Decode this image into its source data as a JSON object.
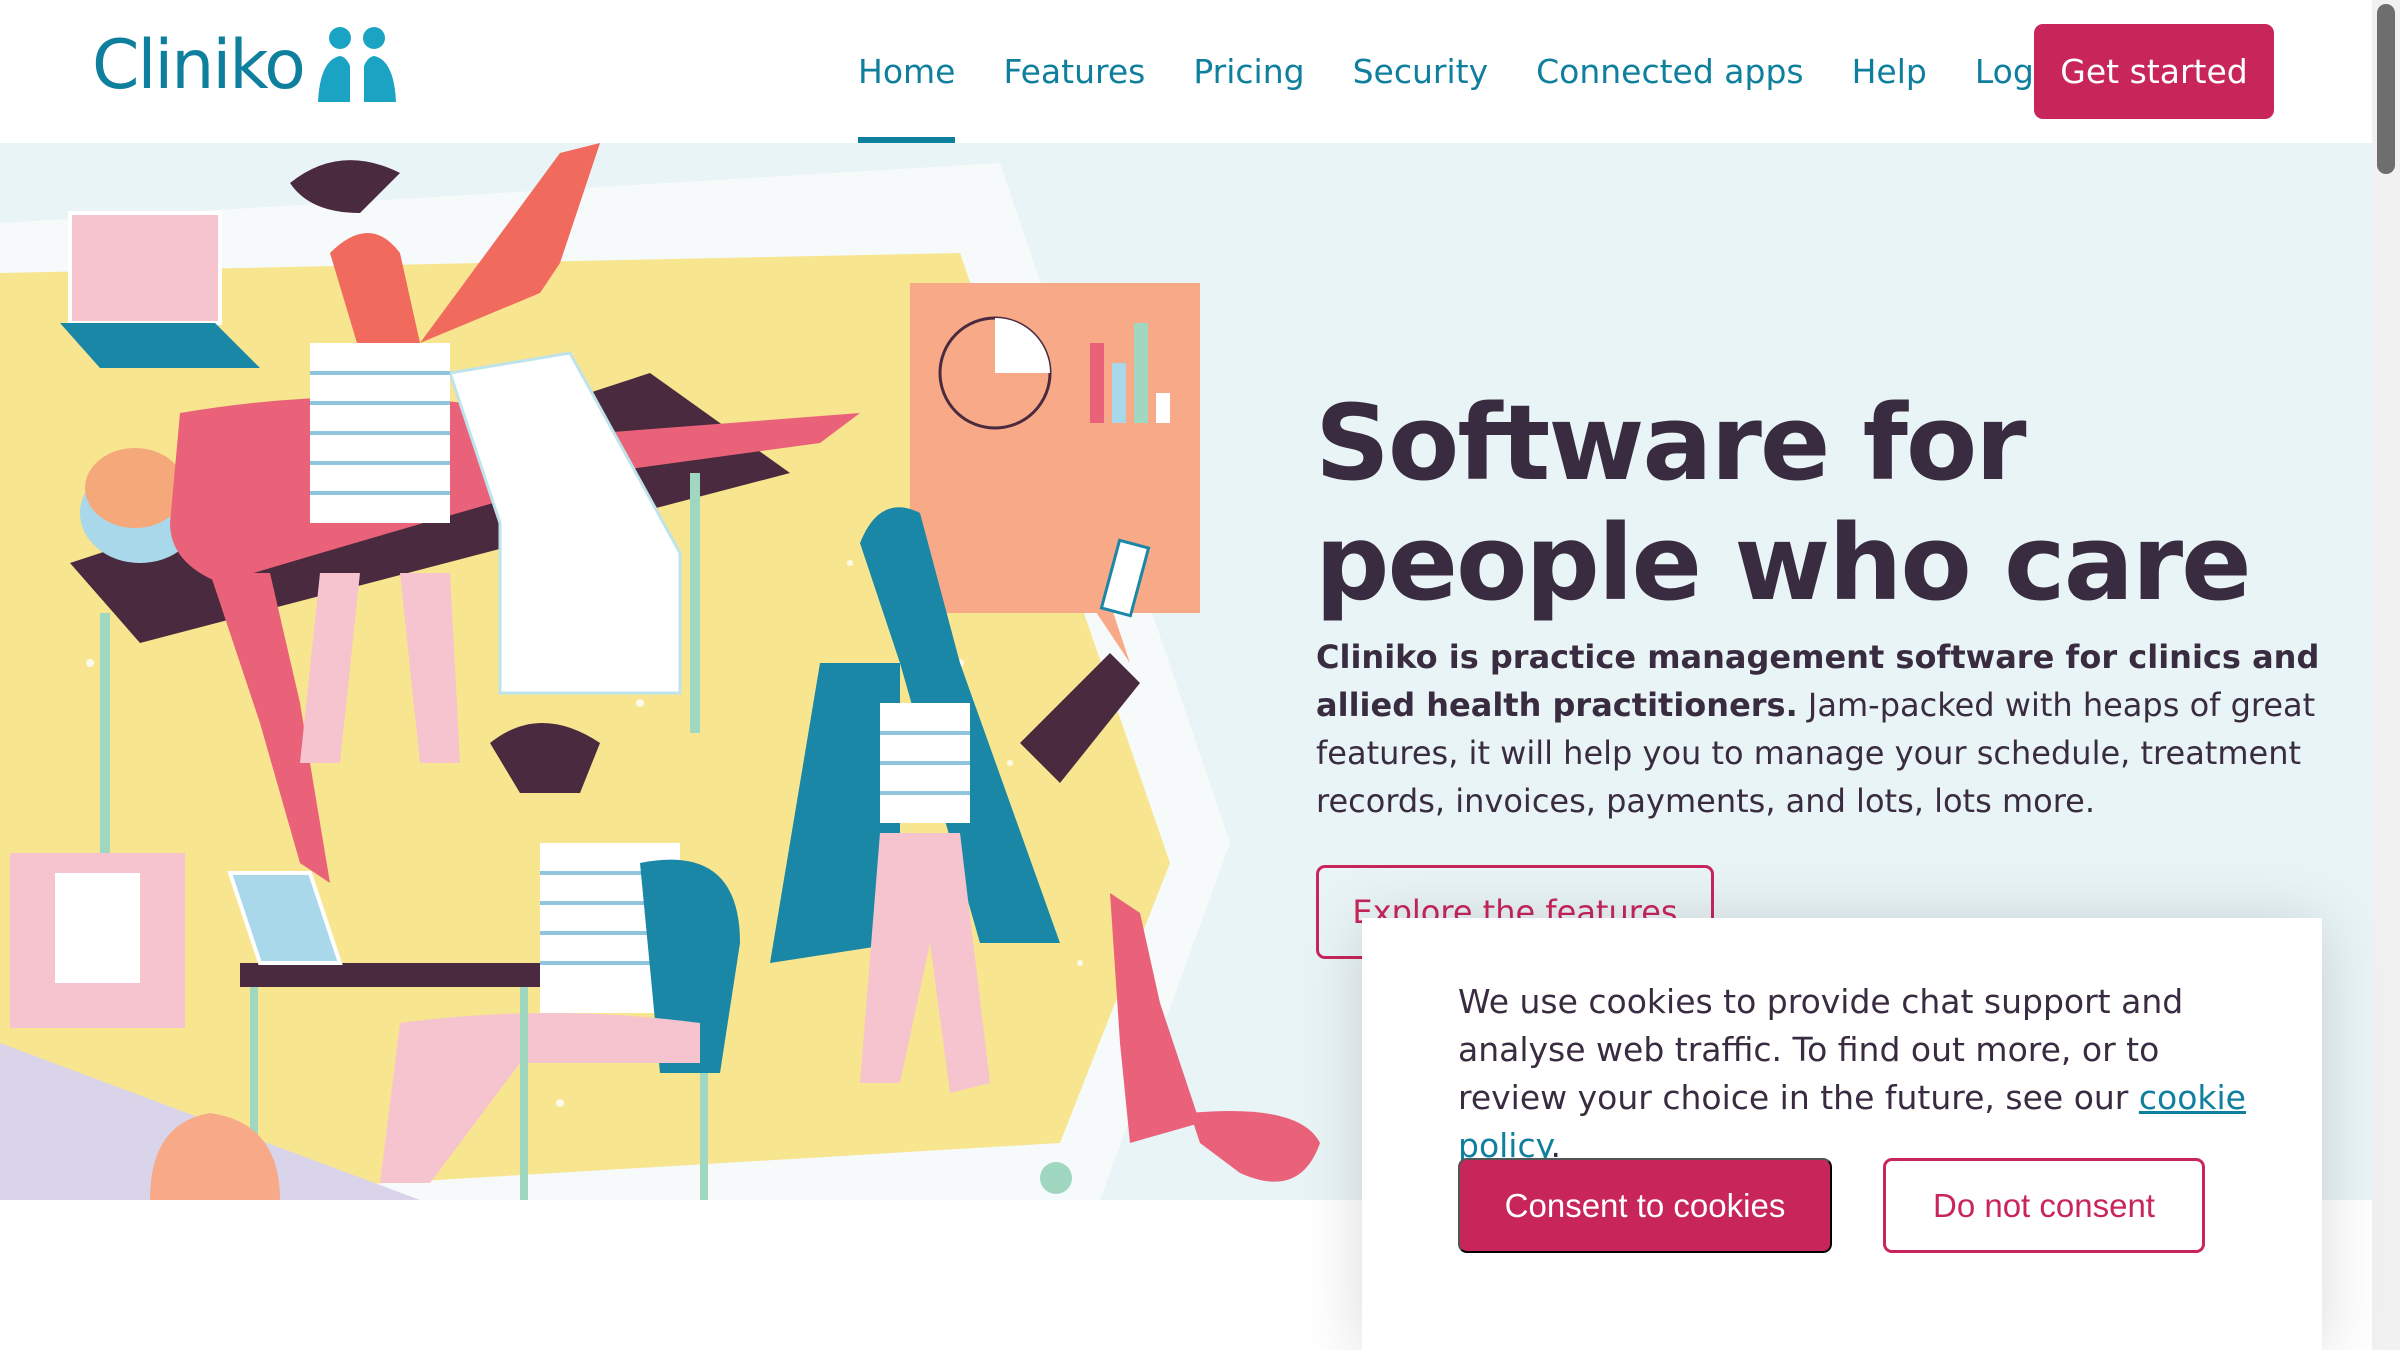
{
  "brand": {
    "name": "Cliniko"
  },
  "nav": {
    "items": [
      {
        "label": "Home",
        "active": true
      },
      {
        "label": "Features"
      },
      {
        "label": "Pricing"
      },
      {
        "label": "Security"
      },
      {
        "label": "Connected apps"
      },
      {
        "label": "Help"
      },
      {
        "label": "Log in"
      }
    ],
    "cta": "Get started"
  },
  "hero": {
    "title": "Software for people who care",
    "intro_bold": "Cliniko is practice management software for clinics and allied health practitioners.",
    "intro_rest": " Jam-packed with heaps of great features, it will help you to manage your schedule, treatment records, invoices, payments, and lots, lots more.",
    "cta": "Explore the features"
  },
  "cookie_banner": {
    "text": "We use cookies to provide chat support and analyse web traffic. To find out more, or to review your choice in the future, see our ",
    "link": "cookie policy",
    "text_end": ".",
    "accept": "Consent to cookies",
    "decline": "Do not consent"
  },
  "colors": {
    "brand_teal": "#0f7f9e",
    "accent_pink": "#c8265a",
    "heading": "#3a2c40",
    "hero_bg": "#e9f4f6"
  }
}
